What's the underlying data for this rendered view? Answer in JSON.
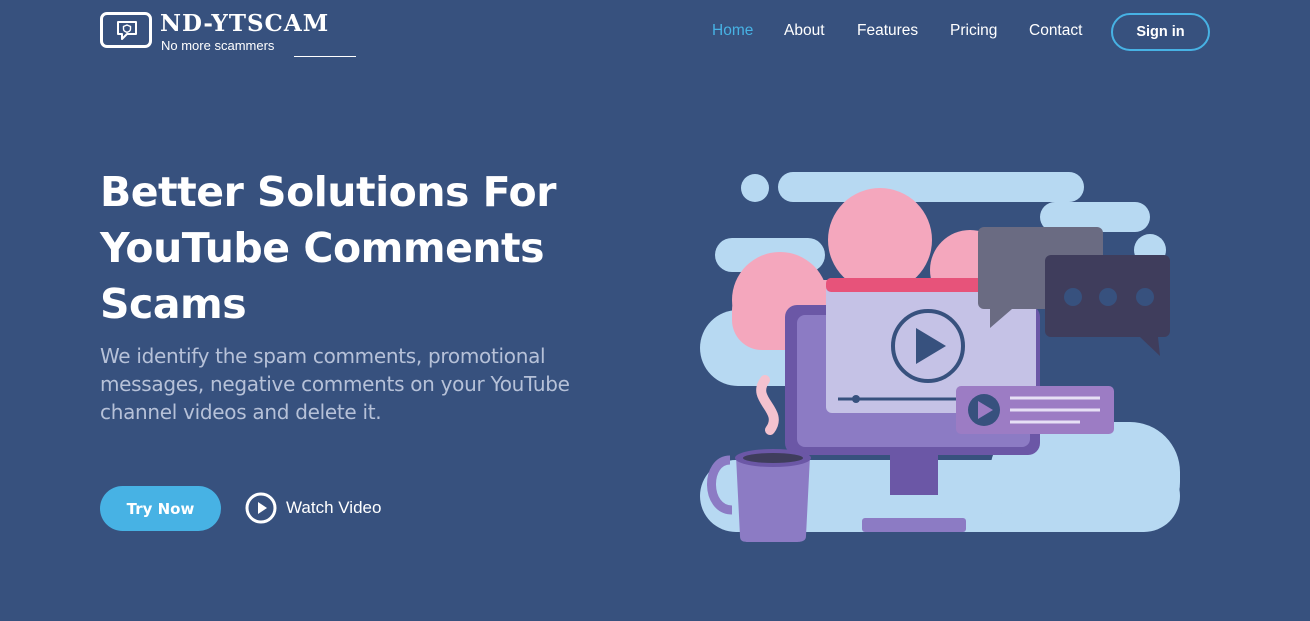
{
  "brand": {
    "name": "ND-YTSCAM",
    "tagline": "No more scammers",
    "logo_icon": "chat-shield-icon"
  },
  "nav": {
    "items": [
      {
        "label": "Home",
        "active": true
      },
      {
        "label": "About",
        "active": false
      },
      {
        "label": "Features",
        "active": false
      },
      {
        "label": "Pricing",
        "active": false
      },
      {
        "label": "Contact",
        "active": false
      }
    ],
    "signin_label": "Sign in"
  },
  "hero": {
    "title": "Better Solutions For YouTube Comments Scams",
    "subtitle": "We identify the spam comments, promotional messages, negative comments on your YouTube channel videos and delete it.",
    "try_label": "Try Now",
    "watch_label": "Watch Video",
    "watch_icon": "play-circle-icon"
  },
  "colors": {
    "background": "#37517e",
    "accent": "#47b2e4",
    "subtitle_text": "#b6c1d8"
  }
}
